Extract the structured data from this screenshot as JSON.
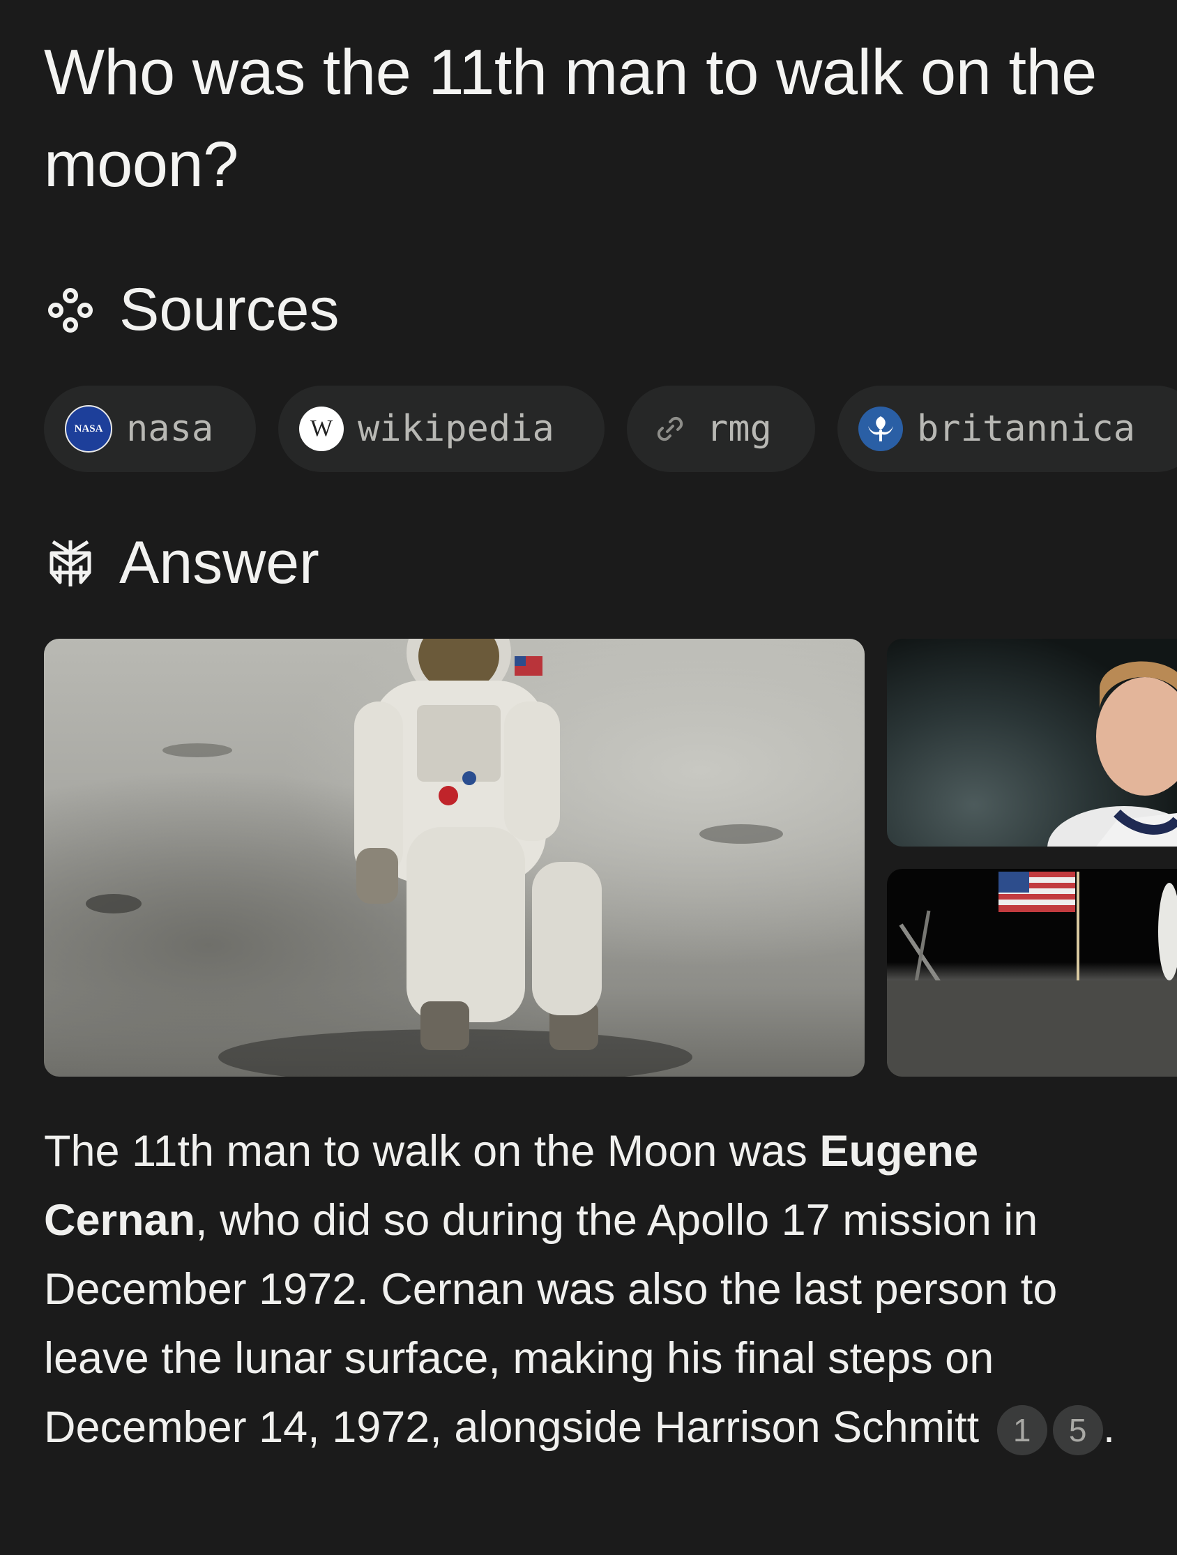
{
  "question": "Who was the 11th man to walk on the moon?",
  "sources": {
    "heading": "Sources",
    "chips": [
      {
        "label": "nasa",
        "icon": "nasa-logo-icon"
      },
      {
        "label": "wikipedia",
        "icon": "wikipedia-w-icon"
      },
      {
        "label": "rmg",
        "icon": "link-icon"
      },
      {
        "label": "britannica",
        "icon": "britannica-thistle-icon"
      }
    ]
  },
  "answer": {
    "heading": "Answer",
    "text_before": "The 11th man to walk on the Moon was ",
    "bold_name": "Eugene Cernan",
    "text_after": ", who did so during the Apollo 17 mission in December 1972. Cernan was also the last person to leave the lunar surface, making his final steps on December 14, 1972, alongside Harrison Schmitt",
    "citations": [
      "1",
      "5"
    ],
    "end": "."
  },
  "images": [
    {
      "name": "astronaut-on-moon-image"
    },
    {
      "name": "moon-and-astronaut-portrait-image"
    },
    {
      "name": "flag-on-moon-image"
    }
  ],
  "nasa_logo_text": "NASA",
  "wiki_logo_text": "W"
}
